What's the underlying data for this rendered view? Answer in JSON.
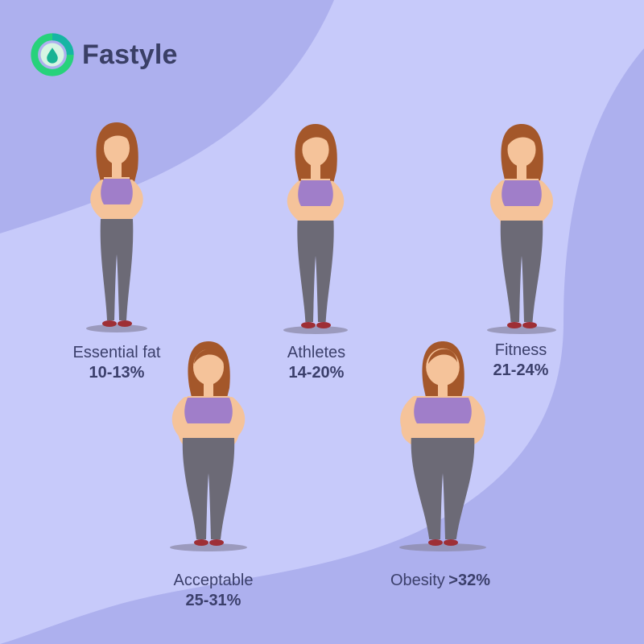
{
  "brand": {
    "name": "Fastyle",
    "logo_icon": "drop-ring-logo-icon",
    "colors": {
      "text": "#3a3f66",
      "ring_green": "#27d27b",
      "ring_teal": "#16b5a4"
    }
  },
  "theme": {
    "background": "#c7cafa",
    "wave_dark": "#aeb2ed",
    "skin": "#f5c39a",
    "hair": "#a4572a",
    "top": "#a07ec9",
    "pants": "#6c6a76",
    "shoes": "#9e2f35"
  },
  "categories": [
    {
      "label": "Essential fat",
      "range": "10-13%",
      "level": 1
    },
    {
      "label": "Athletes",
      "range": "14-20%",
      "level": 2
    },
    {
      "label": "Fitness",
      "range": "21-24%",
      "level": 3
    },
    {
      "label": "Acceptable",
      "range": "25-31%",
      "level": 4
    },
    {
      "label": "Obesity",
      "range": ">32%",
      "level": 5
    }
  ]
}
